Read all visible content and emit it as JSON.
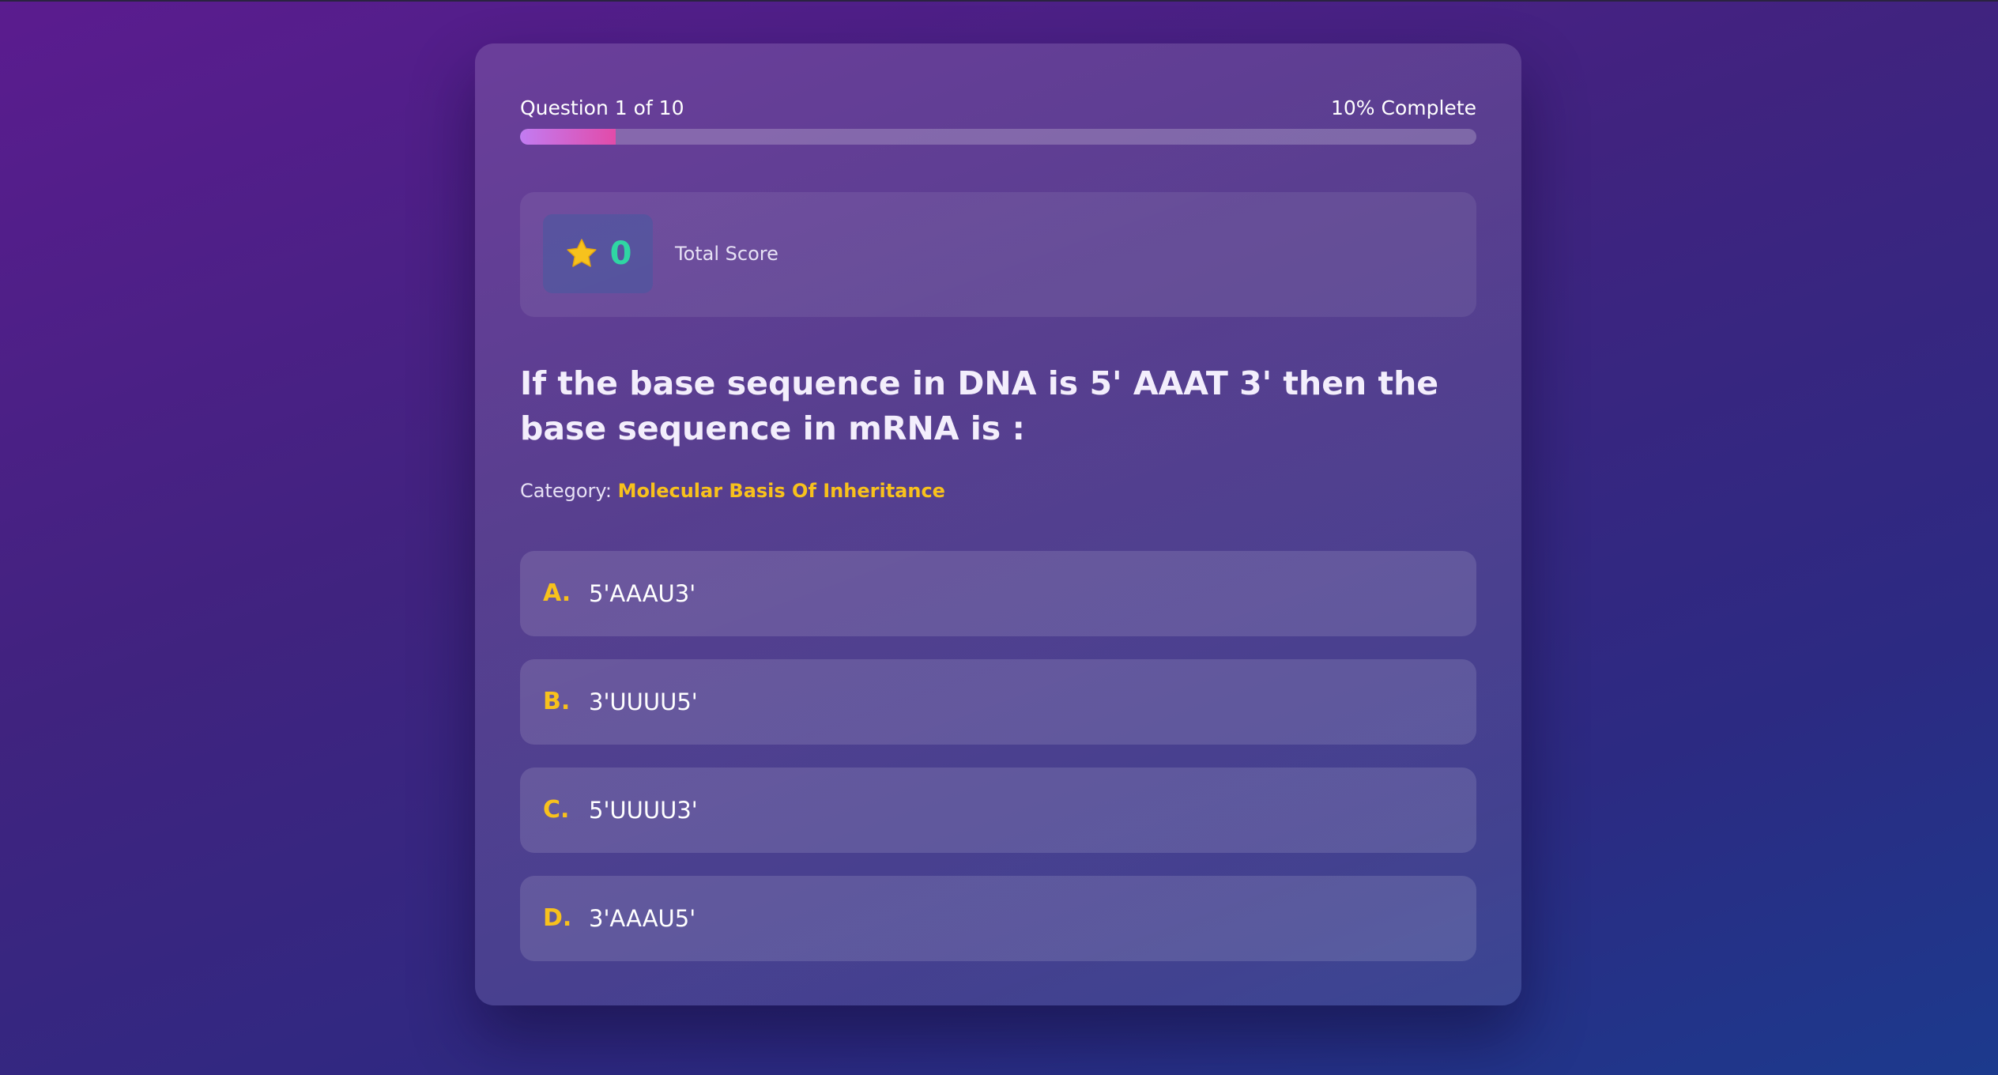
{
  "progress": {
    "question_counter": "Question 1 of 10",
    "percent_label": "10% Complete",
    "fraction": 0.1
  },
  "score": {
    "icon": "star-icon",
    "value": "0",
    "label": "Total Score"
  },
  "question": {
    "text": "If the base sequence in DNA is 5' AAAT 3' then the base sequence in mRNA is :",
    "category_label": "Category:",
    "category_value": "Molecular Basis Of Inheritance"
  },
  "options": [
    {
      "letter": "A.",
      "text": "5'AAAU3'"
    },
    {
      "letter": "B.",
      "text": "3'UUUU5'"
    },
    {
      "letter": "C.",
      "text": "5'UUUU3'"
    },
    {
      "letter": "D.",
      "text": "3'AAAU5'"
    }
  ],
  "colors": {
    "accent_yellow": "#f8c11c",
    "score_green": "#2fd6a3",
    "progress_start": "#c27cf2",
    "progress_end": "#e24ba9"
  }
}
